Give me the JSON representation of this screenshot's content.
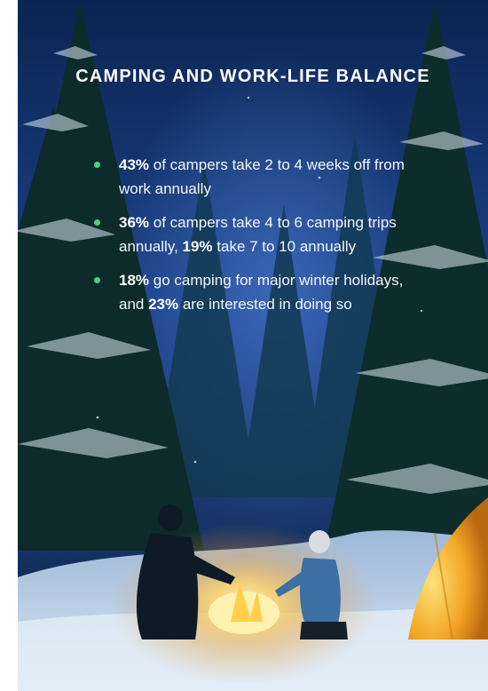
{
  "infographic": {
    "title": "CAMPING AND WORK-LIFE BALANCE",
    "bullets": [
      {
        "stat": "43%",
        "text": " of campers take 2 to 4 weeks off from work annually",
        "stat2": "",
        "text2": ""
      },
      {
        "stat": "36%",
        "text": " of campers take 4 to 6 camping trips annually, ",
        "stat2": "19%",
        "text2": " take 7 to 10 annually"
      },
      {
        "stat": "18%",
        "text": " go camping for major winter holidays, and ",
        "stat2": "23%",
        "text2": " are interested in doing so"
      }
    ]
  },
  "colors": {
    "sky_top": "#0f2f63",
    "sky_glow": "#3a64b2",
    "forest": "#0d2c2a",
    "snow": "#cfe0f0",
    "fire": "#ffd26a",
    "tent": "#f2a524",
    "bullet_dot": "#4fd07c"
  }
}
